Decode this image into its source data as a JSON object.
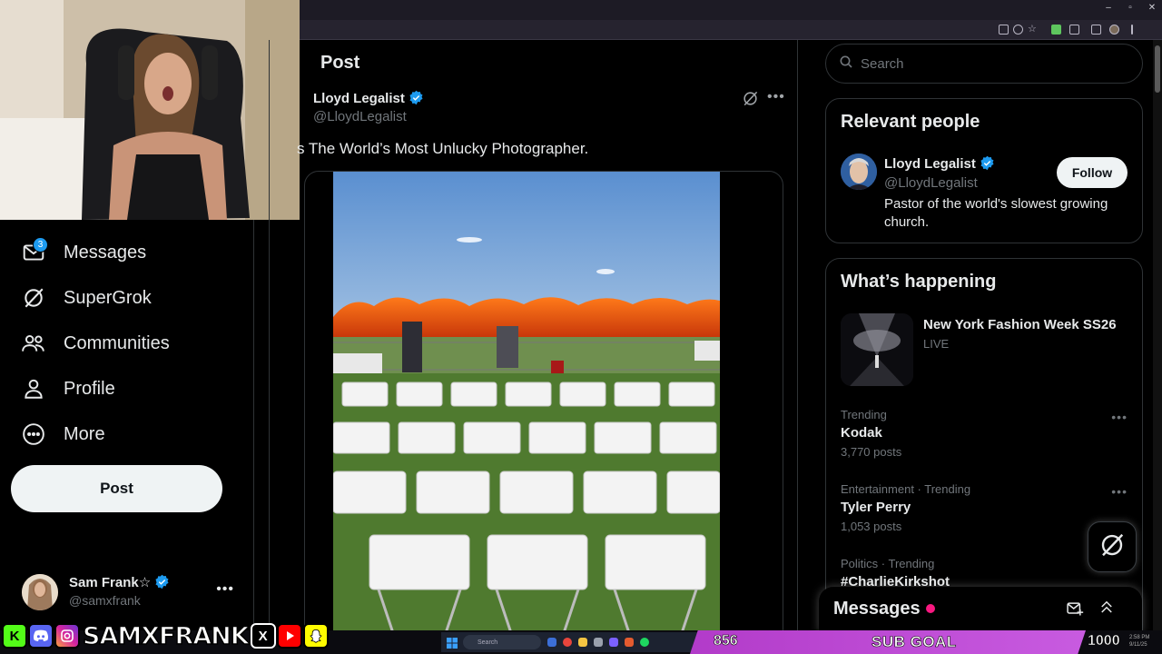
{
  "main": {
    "title": "Post",
    "author_name": "Lloyd Legalist",
    "author_handle": "@LloydLegalist",
    "tweet_text": "s The World’s Most Unlucky Photographer."
  },
  "sidebar": {
    "items": [
      {
        "label": "Messages",
        "icon": "envelope-icon",
        "badge": "3"
      },
      {
        "label": "SuperGrok",
        "icon": "grok-icon"
      },
      {
        "label": "Communities",
        "icon": "people-icon"
      },
      {
        "label": "Profile",
        "icon": "person-icon"
      },
      {
        "label": "More",
        "icon": "more-circle-icon"
      }
    ],
    "post_button": "Post",
    "account": {
      "name": "Sam Frank☆",
      "handle": "@samxfrank"
    }
  },
  "search": {
    "placeholder": "Search"
  },
  "relevant_people": {
    "title": "Relevant people",
    "person": {
      "name": "Lloyd Legalist",
      "handle": "@LloydLegalist",
      "bio": "Pastor of the world's slowest growing church.",
      "follow_label": "Follow"
    }
  },
  "happening": {
    "title": "What’s happening",
    "headline": {
      "title": "New York Fashion Week SS26",
      "status": "LIVE"
    },
    "trends": [
      {
        "context": "Trending",
        "name": "Kodak",
        "count": "3,770 posts"
      },
      {
        "context": "Entertainment · Trending",
        "name": "Tyler Perry",
        "count": "1,053 posts"
      },
      {
        "context": "Politics · Trending",
        "name": "#CharlieKirkshot",
        "count": ""
      }
    ]
  },
  "messages_drawer": {
    "title": "Messages"
  },
  "overlay": {
    "brand": "SAMXFRANK",
    "social_letters": [
      "K",
      "X"
    ],
    "sub_current": "856",
    "sub_goal_label": "SUB GOAL",
    "sub_target": "1000",
    "taskbar_search": "Search"
  },
  "colors": {
    "accent": "#1d9bf0",
    "goal_bar": "#c04fd8",
    "notification": "#f91880"
  }
}
